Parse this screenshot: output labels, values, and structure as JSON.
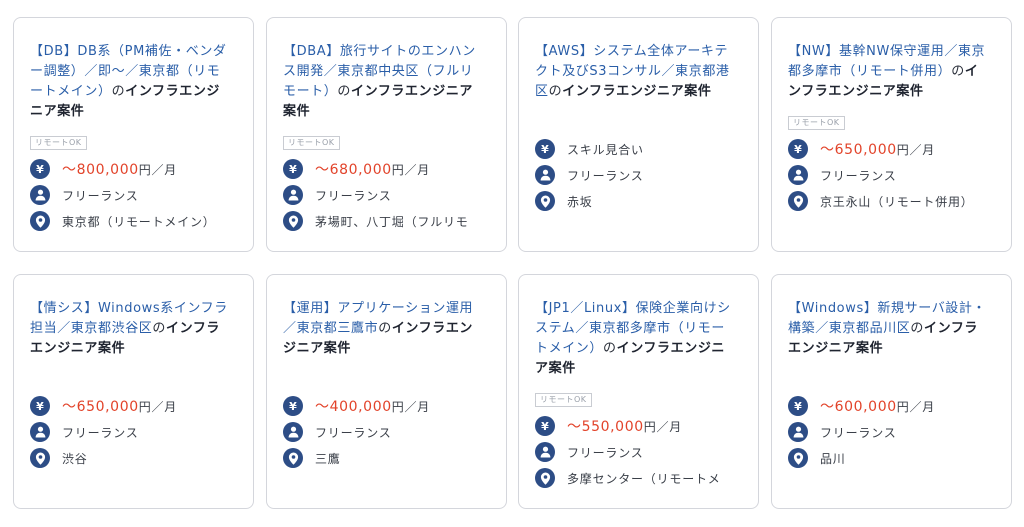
{
  "cards": [
    {
      "title_parts": [
        {
          "t": "【DB】DB系（PM補佐・ベンダー調整）／即〜／東京都（リモートメイン）",
          "c": "hl"
        },
        {
          "t": "の",
          "c": ""
        },
        {
          "t": "インフラエンジニア案件",
          "c": "bold"
        }
      ],
      "badge": "リモートOK",
      "price_prefix": "〜",
      "price": "800,000",
      "price_unit": "円／月",
      "contract": "フリーランス",
      "location": "東京都（リモートメイン）"
    },
    {
      "title_parts": [
        {
          "t": "【DBA】旅行サイトのエンハンス開発／東京都中央区（フルリモート）",
          "c": "hl"
        },
        {
          "t": "の",
          "c": ""
        },
        {
          "t": "インフラエンジニア案件",
          "c": "bold"
        }
      ],
      "badge": "リモートOK",
      "price_prefix": "〜",
      "price": "680,000",
      "price_unit": "円／月",
      "contract": "フリーランス",
      "location": "茅場町、八丁堀（フルリモ"
    },
    {
      "title_parts": [
        {
          "t": "【AWS】システム全体アーキテクト及びS3コンサル／東京都港区",
          "c": "hl"
        },
        {
          "t": "の",
          "c": ""
        },
        {
          "t": "インフラエンジニア案件",
          "c": "bold"
        }
      ],
      "badge": "",
      "price_text": "スキル見合い",
      "contract": "フリーランス",
      "location": "赤坂"
    },
    {
      "title_parts": [
        {
          "t": "【NW】基幹NW保守運用／東京都多摩市（リモート併用）",
          "c": "hl"
        },
        {
          "t": "の",
          "c": ""
        },
        {
          "t": "インフラエンジニア案件",
          "c": "bold"
        }
      ],
      "badge": "リモートOK",
      "price_prefix": "〜",
      "price": "650,000",
      "price_unit": "円／月",
      "contract": "フリーランス",
      "location": "京王永山（リモート併用）"
    },
    {
      "title_parts": [
        {
          "t": "【情シス】Windows系インフラ担当／東京都渋谷区",
          "c": "hl"
        },
        {
          "t": "の",
          "c": ""
        },
        {
          "t": "インフラエンジニア案件",
          "c": "bold"
        }
      ],
      "badge": "",
      "price_prefix": "〜",
      "price": "650,000",
      "price_unit": "円／月",
      "contract": "フリーランス",
      "location": "渋谷"
    },
    {
      "title_parts": [
        {
          "t": "【運用】アプリケーション運用／東京都三鷹市",
          "c": "hl"
        },
        {
          "t": "の",
          "c": ""
        },
        {
          "t": "インフラエンジニア案件",
          "c": "bold"
        }
      ],
      "badge": "",
      "price_prefix": "〜",
      "price": "400,000",
      "price_unit": "円／月",
      "contract": "フリーランス",
      "location": "三鷹"
    },
    {
      "title_parts": [
        {
          "t": "【JP1／Linux】保険企業向けシステム／東京都多摩市（リモートメイン）",
          "c": "hl"
        },
        {
          "t": "の",
          "c": ""
        },
        {
          "t": "インフラエンジニア案件",
          "c": "bold"
        }
      ],
      "badge": "リモートOK",
      "price_prefix": "〜",
      "price": "550,000",
      "price_unit": "円／月",
      "contract": "フリーランス",
      "location": "多摩センター（リモートメ"
    },
    {
      "title_parts": [
        {
          "t": "【Windows】新規サーバ設計・構築／東京都品川区",
          "c": "hl"
        },
        {
          "t": "の",
          "c": ""
        },
        {
          "t": "インフラエンジニア案件",
          "c": "bold"
        }
      ],
      "badge": "",
      "price_prefix": "〜",
      "price": "600,000",
      "price_unit": "円／月",
      "contract": "フリーランス",
      "location": "品川"
    }
  ],
  "icons": {
    "price": "yen-icon",
    "contract": "person-icon",
    "location": "map-pin-icon"
  },
  "colors": {
    "accent": "#2d4d86",
    "price": "#e2432a",
    "title_link": "#2a5ea8"
  }
}
